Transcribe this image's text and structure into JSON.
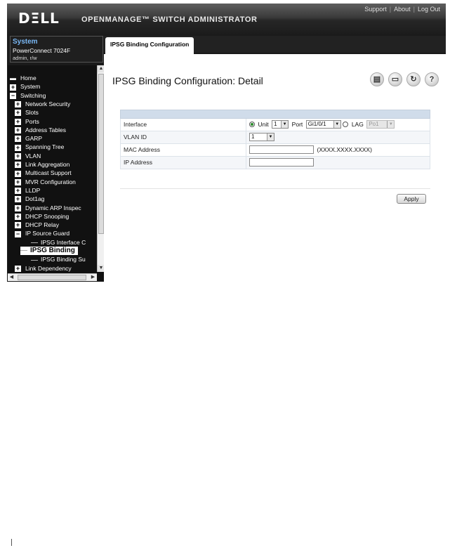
{
  "header": {
    "logo": "DΞLL",
    "product": "OPENMANAGE™ SWITCH ADMINISTRATOR",
    "links": [
      "Support",
      "About",
      "Log Out"
    ]
  },
  "system": {
    "title": "System",
    "model": "PowerConnect 7024F",
    "user": "admin, r/w"
  },
  "nav": {
    "items": [
      {
        "label": "Home",
        "level": 0,
        "kind": "home"
      },
      {
        "label": "System",
        "level": 0,
        "kind": "plus"
      },
      {
        "label": "Switching",
        "level": 0,
        "kind": "minus"
      },
      {
        "label": "Network Security",
        "level": 1,
        "kind": "plus"
      },
      {
        "label": "Slots",
        "level": 1,
        "kind": "plus"
      },
      {
        "label": "Ports",
        "level": 1,
        "kind": "plus"
      },
      {
        "label": "Address Tables",
        "level": 1,
        "kind": "plus"
      },
      {
        "label": "GARP",
        "level": 1,
        "kind": "plus"
      },
      {
        "label": "Spanning Tree",
        "level": 1,
        "kind": "plus"
      },
      {
        "label": "VLAN",
        "level": 1,
        "kind": "plus"
      },
      {
        "label": "Link Aggregation",
        "level": 1,
        "kind": "plus"
      },
      {
        "label": "Multicast Support",
        "level": 1,
        "kind": "plus"
      },
      {
        "label": "MVR Configuration",
        "level": 1,
        "kind": "plus"
      },
      {
        "label": "LLDP",
        "level": 1,
        "kind": "plus"
      },
      {
        "label": "Dot1ag",
        "level": 1,
        "kind": "plus"
      },
      {
        "label": "Dynamic ARP Inspec",
        "level": 1,
        "kind": "plus"
      },
      {
        "label": "DHCP Snooping",
        "level": 1,
        "kind": "plus"
      },
      {
        "label": "DHCP Relay",
        "level": 1,
        "kind": "plus"
      },
      {
        "label": "IP Source Guard",
        "level": 1,
        "kind": "minus"
      },
      {
        "label": "IPSG Interface C",
        "level": 2,
        "kind": "leaf"
      },
      {
        "label": "IPSG Binding",
        "level": 2,
        "kind": "leaf",
        "selected": true
      },
      {
        "label": "IPSG Binding Su",
        "level": 2,
        "kind": "leaf"
      },
      {
        "label": "Link Dependency",
        "level": 1,
        "kind": "plus"
      }
    ]
  },
  "tab": {
    "label": "IPSG Binding Configuration"
  },
  "page": {
    "title": "IPSG Binding Configuration: Detail",
    "icons": [
      "save-icon",
      "print-icon",
      "refresh-icon",
      "help-icon"
    ]
  },
  "form": {
    "interface_label": "Interface",
    "unit_label": "Unit",
    "unit_value": "1",
    "port_label": "Port",
    "port_value": "Gi1/0/1",
    "lag_label": "LAG",
    "lag_value": "Po1",
    "vlan_label": "VLAN ID",
    "vlan_value": "1",
    "mac_label": "MAC Address",
    "mac_value": "",
    "mac_hint": "(XXXX.XXXX.XXXX)",
    "ip_label": "IP Address",
    "ip_value": ""
  },
  "apply_label": "Apply"
}
